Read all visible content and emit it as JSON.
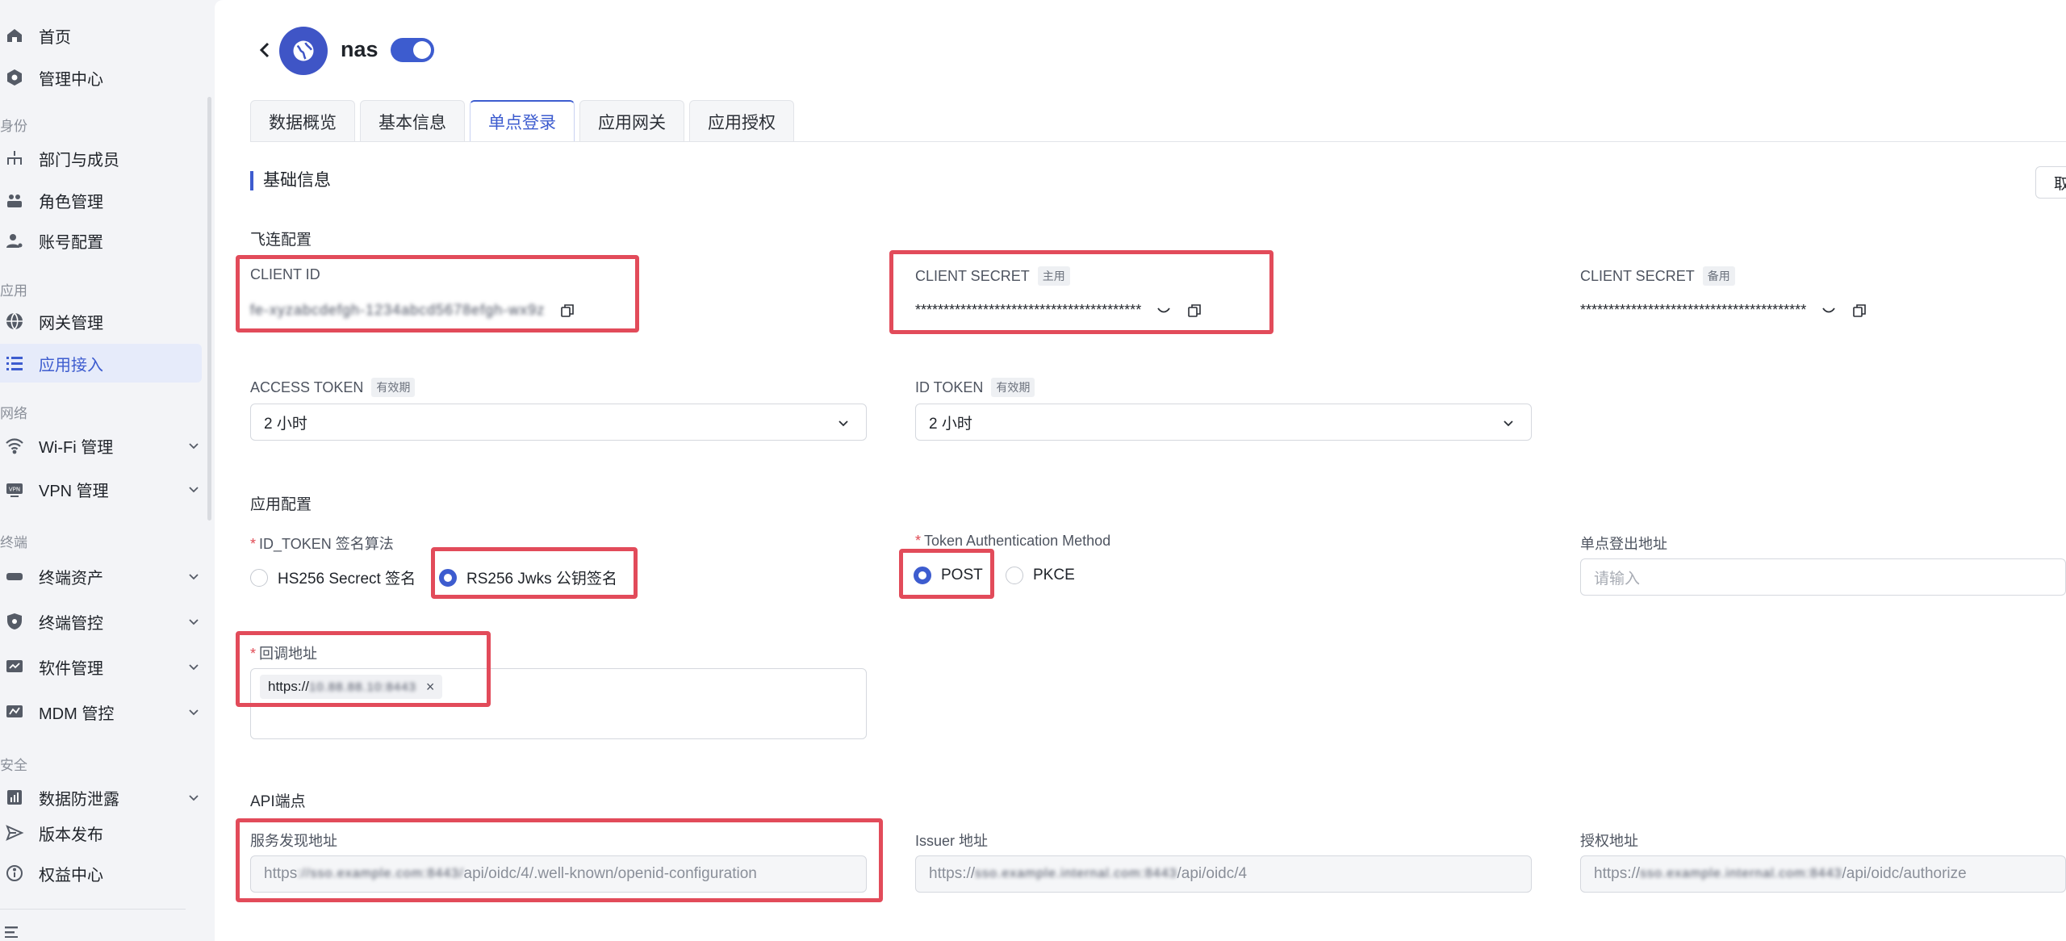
{
  "sidebar": {
    "items": [
      {
        "label": "首页",
        "icon": "home-icon"
      },
      {
        "label": "管理中心",
        "icon": "admin-center-icon"
      },
      {
        "label": "部门与成员",
        "icon": "org-tree-icon"
      },
      {
        "label": "角色管理",
        "icon": "roles-icon"
      },
      {
        "label": "账号配置",
        "icon": "account-config-icon"
      },
      {
        "label": "网关管理",
        "icon": "globe-icon"
      },
      {
        "label": "应用接入",
        "icon": "list-icon"
      },
      {
        "label": "Wi-Fi 管理",
        "icon": "wifi-icon"
      },
      {
        "label": "VPN 管理",
        "icon": "vpn-icon"
      },
      {
        "label": "终端资产",
        "icon": "device-icon"
      },
      {
        "label": "终端管控",
        "icon": "shield-icon"
      },
      {
        "label": "软件管理",
        "icon": "software-icon"
      },
      {
        "label": "MDM 管控",
        "icon": "mdm-icon"
      },
      {
        "label": "数据防泄露",
        "icon": "dlp-icon"
      },
      {
        "label": "版本发布",
        "icon": "send-icon"
      },
      {
        "label": "权益中心",
        "icon": "info-icon"
      }
    ],
    "sections": {
      "identity": "身份",
      "apps": "应用",
      "network": "网络",
      "terminal": "终端",
      "security": "安全"
    },
    "active_item": "应用接入"
  },
  "header": {
    "app_name": "nas",
    "enabled": true
  },
  "tabs": [
    "数据概览",
    "基本信息",
    "单点登录",
    "应用网关",
    "应用授权"
  ],
  "active_tab": "单点登录",
  "section": {
    "title": "基础信息",
    "cancel_label": "取"
  },
  "feilian": {
    "title": "飞连配置",
    "client_id_label": "CLIENT ID",
    "client_id_value": "fe-xyzabcdefgh-1234abcd5678efgh-wx9z",
    "client_secret_label": "CLIENT SECRET",
    "client_secret_badge": "主用",
    "client_secret_value": "****************************************",
    "client_secret_backup_label": "CLIENT SECRET",
    "client_secret_backup_badge": "备用",
    "client_secret_backup_value": "****************************************",
    "access_token_label": "ACCESS TOKEN",
    "access_token_badge": "有效期",
    "access_token_value": "2 小时",
    "id_token_label": "ID TOKEN",
    "id_token_badge": "有效期",
    "id_token_value": "2 小时"
  },
  "app_config": {
    "title": "应用配置",
    "sign_alg_label": "ID_TOKEN 签名算法",
    "sign_alg_options": [
      "HS256 Secrect 签名",
      "RS256 Jwks 公钥签名"
    ],
    "sign_alg_selected": "RS256 Jwks 公钥签名",
    "auth_method_label": "Token Authentication Method",
    "auth_method_options": [
      "POST",
      "PKCE"
    ],
    "auth_method_selected": "POST",
    "logout_label": "单点登出地址",
    "logout_placeholder": "请输入",
    "callback_label": "回调地址",
    "callback_tag_prefix": "https://",
    "callback_tag_host": "10.88.88.10:8443"
  },
  "api": {
    "title": "API端点",
    "discovery_label": "服务发现地址",
    "discovery_prefix": "https",
    "discovery_host": "://sso.example.com:8443/",
    "discovery_path": "api/oidc/4/.well-known/openid-configuration",
    "issuer_label": "Issuer 地址",
    "issuer_prefix": "https://",
    "issuer_host": "sso.example.internal.com:8443",
    "issuer_path": "/api/oidc/4",
    "auth_label": "授权地址",
    "auth_prefix": "https://",
    "auth_host": "sso.example.internal.com:8443",
    "auth_path": "/api/oidc/authorize"
  },
  "colors": {
    "accent": "#3d5ccf",
    "highlight": "#e24b5a",
    "required": "#e04a54"
  }
}
